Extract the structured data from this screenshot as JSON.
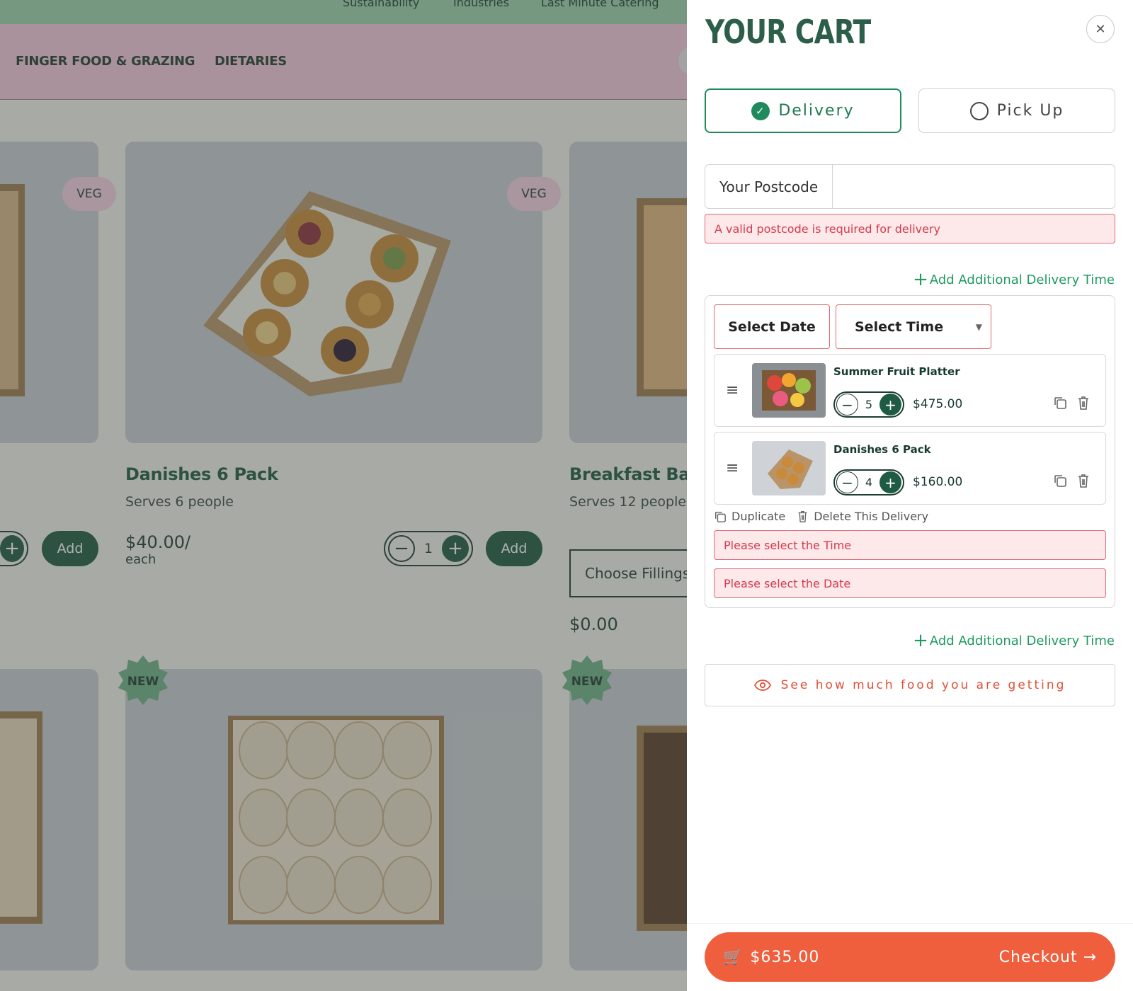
{
  "background": {
    "top_links": [
      "Sustainability",
      "Industries",
      "Last Minute Catering"
    ],
    "categories": [
      "FINGER FOOD & GRAZING",
      "DIETARIES"
    ],
    "badges": {
      "veg": "VEG",
      "new": "NEW"
    },
    "add_label": "Add",
    "products": [
      {
        "title": "Danishes 6 Pack",
        "serves": "Serves 6 people",
        "price": "$40.00/",
        "unit": "each",
        "qty": "1"
      },
      {
        "title": "Breakfast Baguettes",
        "serves": "Serves 12 people",
        "choose": "Choose Fillings",
        "price": "$0.00"
      }
    ]
  },
  "cart": {
    "title": "YOUR CART",
    "modes": {
      "delivery": "Delivery",
      "pickup": "Pick Up",
      "selected": "delivery"
    },
    "postcode": {
      "label": "Your Postcode",
      "value": "",
      "placeholder": ""
    },
    "postcode_error": "A valid postcode is required for delivery",
    "add_delivery_time": "Add Additional Delivery Time",
    "delivery": {
      "select_date": "Select Date",
      "select_time": "Select Time",
      "items": [
        {
          "name": "Summer Fruit Platter",
          "qty": "5",
          "price": "$475.00"
        },
        {
          "name": "Danishes 6 Pack",
          "qty": "4",
          "price": "$160.00"
        }
      ],
      "duplicate": "Duplicate",
      "delete": "Delete This Delivery",
      "time_error": "Please select the Time",
      "date_error": "Please select the Date"
    },
    "see_food": "See how much food you are getting",
    "total": "$635.00",
    "checkout": "Checkout"
  },
  "colors": {
    "accent_green": "#1f5b43",
    "checkout_orange": "#ef5f3d",
    "error_red": "#d43b4c"
  },
  "icons": [
    "close-icon",
    "check-icon",
    "radio-icon",
    "plus-icon",
    "drag-handle-icon",
    "duplicate-icon",
    "trash-icon",
    "eye-icon",
    "cart-icon",
    "arrow-right-icon"
  ]
}
